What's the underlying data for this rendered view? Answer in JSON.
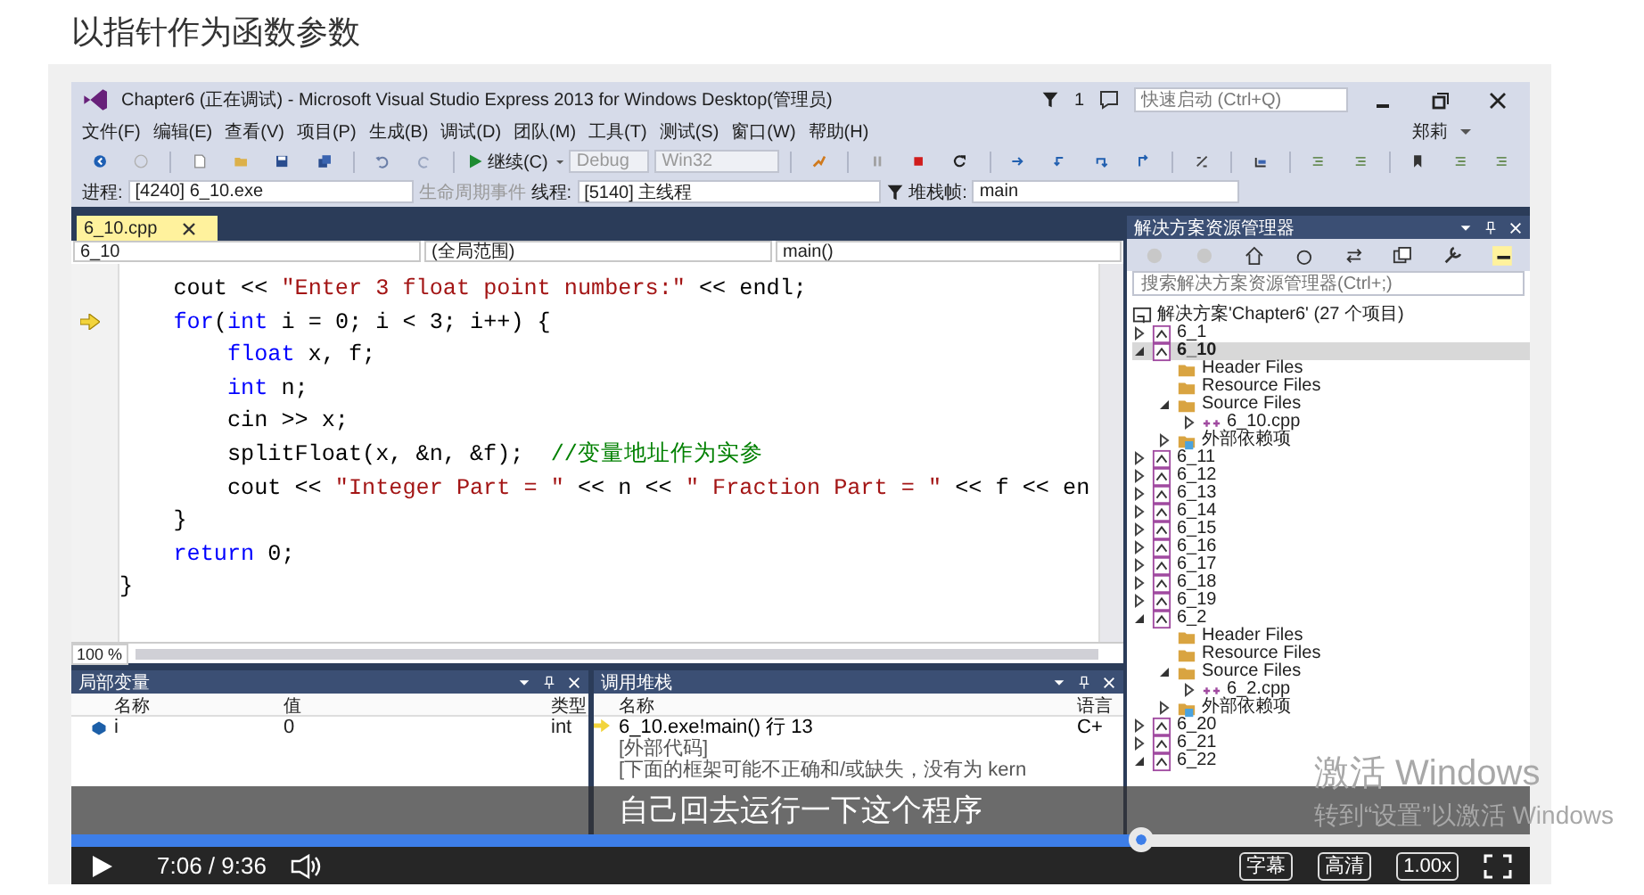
{
  "page": {
    "title": "以指针作为函数参数"
  },
  "vs": {
    "title": "Chapter6 (正在调试) - Microsoft Visual Studio Express 2013 for Windows Desktop(管理员)",
    "notifications": "1",
    "quick_launch": {
      "placeholder": "快速启动 (Ctrl+Q)"
    },
    "menu": [
      "文件(F)",
      "编辑(E)",
      "查看(V)",
      "项目(P)",
      "生成(B)",
      "调试(D)",
      "团队(M)",
      "工具(T)",
      "测试(S)",
      "窗口(W)",
      "帮助(H)"
    ],
    "user": "郑莉",
    "toolbar": {
      "continue": "继续(C)",
      "configuration": "Debug",
      "platform": "Win32"
    },
    "debug_location": {
      "process_label": "进程:",
      "process": "[4240] 6_10.exe",
      "lifecycle": "生命周期事件",
      "thread_label": "线程:",
      "thread": "[5140] 主线程",
      "frame_label": "堆栈帧:",
      "frame": "main"
    },
    "document_tabs": [
      {
        "label": "6_10.cpp",
        "selected": true
      }
    ],
    "navigation": [
      "6_10",
      "(全局范围)",
      "main()"
    ],
    "code": [
      {
        "current": false,
        "tokens": [
          {
            "kind": "plain",
            "text": "    cout << "
          },
          {
            "kind": "string",
            "text": "\"Enter 3 float point numbers:\""
          },
          {
            "kind": "plain",
            "text": " << endl;"
          }
        ]
      },
      {
        "current": true,
        "tokens": [
          {
            "kind": "keyword",
            "text": "    for"
          },
          {
            "kind": "plain",
            "text": "("
          },
          {
            "kind": "keyword",
            "text": "int"
          },
          {
            "kind": "plain",
            "text": " i = 0; i < 3; i++) {"
          }
        ]
      },
      {
        "current": false,
        "tokens": [
          {
            "kind": "keyword",
            "text": "        float"
          },
          {
            "kind": "plain",
            "text": " x, f;"
          }
        ]
      },
      {
        "current": false,
        "tokens": [
          {
            "kind": "keyword",
            "text": "        int"
          },
          {
            "kind": "plain",
            "text": " n;"
          }
        ]
      },
      {
        "current": false,
        "tokens": [
          {
            "kind": "plain",
            "text": "        cin >> x;"
          }
        ]
      },
      {
        "current": false,
        "tokens": [
          {
            "kind": "plain",
            "text": "        splitFloat(x, &n, &f);  "
          },
          {
            "kind": "comment",
            "text": "//变量地址作为实参"
          }
        ]
      },
      {
        "current": false,
        "tokens": [
          {
            "kind": "plain",
            "text": "        cout << "
          },
          {
            "kind": "string",
            "text": "\"Integer Part = \""
          },
          {
            "kind": "plain",
            "text": " << n << "
          },
          {
            "kind": "string",
            "text": "\" Fraction Part = \""
          },
          {
            "kind": "plain",
            "text": " << f << en"
          }
        ]
      },
      {
        "current": false,
        "tokens": [
          {
            "kind": "plain",
            "text": "    }"
          }
        ]
      },
      {
        "current": false,
        "tokens": [
          {
            "kind": "keyword",
            "text": "    return"
          },
          {
            "kind": "plain",
            "text": " 0;"
          }
        ]
      },
      {
        "current": false,
        "tokens": [
          {
            "kind": "plain",
            "text": "}"
          }
        ]
      }
    ],
    "zoom": "100 %",
    "locals": {
      "title": "局部变量",
      "columns": [
        "名称",
        "值",
        "类型"
      ],
      "rows": [
        [
          "i",
          "0",
          "int"
        ]
      ]
    },
    "call_stack": {
      "title": "调用堆栈",
      "columns": [
        "名称",
        "语言"
      ],
      "rows": [
        {
          "current": true,
          "cells": [
            "6_10.exe!main() 行 13",
            "C+"
          ]
        },
        {
          "current": false,
          "cells": [
            "[外部代码]"
          ]
        },
        {
          "current": false,
          "cells": [
            "[下面的框架可能不正确和/或缺失，没有为 kern"
          ]
        }
      ]
    },
    "solution_explorer": {
      "title": "解决方案资源管理器",
      "search": {
        "placeholder": "搜索解决方案资源管理器(Ctrl+;)"
      },
      "solution": "解决方案'Chapter6' (27 个项目)",
      "tree": [
        {
          "label": "6_1",
          "kind": "project",
          "expanded": false,
          "selected": false
        },
        {
          "label": "6_10",
          "kind": "project",
          "expanded": true,
          "selected": true,
          "children": [
            {
              "label": "Header Files",
              "kind": "folder",
              "selected": false
            },
            {
              "label": "Resource Files",
              "kind": "folder",
              "selected": false
            },
            {
              "label": "Source Files",
              "kind": "folder",
              "expanded": true,
              "selected": false,
              "children": [
                {
                  "label": "6_10.cpp",
                  "kind": "file",
                  "expanded": false,
                  "selected": false
                }
              ]
            },
            {
              "label": "外部依赖项",
              "kind": "references",
              "expanded": false,
              "selected": false
            }
          ]
        },
        {
          "label": "6_11",
          "kind": "project",
          "expanded": false,
          "selected": false
        },
        {
          "label": "6_12",
          "kind": "project",
          "expanded": false,
          "selected": false
        },
        {
          "label": "6_13",
          "kind": "project",
          "expanded": false,
          "selected": false
        },
        {
          "label": "6_14",
          "kind": "project",
          "expanded": false,
          "selected": false
        },
        {
          "label": "6_15",
          "kind": "project",
          "expanded": false,
          "selected": false
        },
        {
          "label": "6_16",
          "kind": "project",
          "expanded": false,
          "selected": false
        },
        {
          "label": "6_17",
          "kind": "project",
          "expanded": false,
          "selected": false
        },
        {
          "label": "6_18",
          "kind": "project",
          "expanded": false,
          "selected": false
        },
        {
          "label": "6_19",
          "kind": "project",
          "expanded": false,
          "selected": false
        },
        {
          "label": "6_2",
          "kind": "project",
          "expanded": true,
          "selected": false,
          "children": [
            {
              "label": "Header Files",
              "kind": "folder",
              "selected": false
            },
            {
              "label": "Resource Files",
              "kind": "folder",
              "selected": false
            },
            {
              "label": "Source Files",
              "kind": "folder",
              "expanded": true,
              "selected": false,
              "children": [
                {
                  "label": "6_2.cpp",
                  "kind": "file",
                  "expanded": false,
                  "selected": false
                }
              ]
            },
            {
              "label": "外部依赖项",
              "kind": "references",
              "expanded": false,
              "selected": false
            }
          ]
        },
        {
          "label": "6_20",
          "kind": "project",
          "expanded": false,
          "selected": false
        },
        {
          "label": "6_21",
          "kind": "project",
          "expanded": false,
          "selected": false
        },
        {
          "label": "6_22",
          "kind": "project",
          "expanded": true,
          "selected": false
        }
      ]
    }
  },
  "player": {
    "subtitle": "自己回去运行一下这个程序",
    "progress": {
      "level": 0.734
    },
    "time": "7:06 / 9:36",
    "buttons": [
      "字幕",
      "高清",
      "1.00x"
    ]
  },
  "os_notice": {
    "title": "激活 Windows",
    "message": "转到“设置”以激活 Windows"
  }
}
